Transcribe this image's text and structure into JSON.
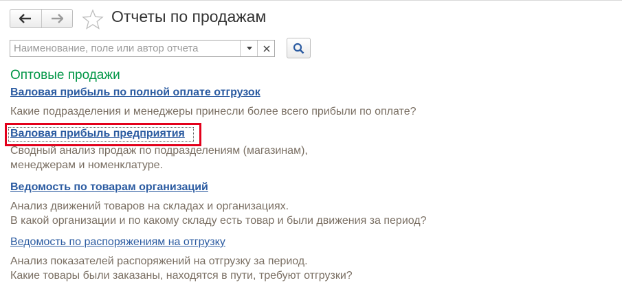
{
  "window": {
    "title": "Отчеты по продажам"
  },
  "search": {
    "placeholder": "Наименование, поле или автор отчета",
    "value": ""
  },
  "groups": [
    {
      "title": "Оптовые продажи",
      "reports": [
        {
          "name": "Валовая прибыль по полной оплате отгрузок",
          "description": "Какие подразделения и менеджеры принесли более всего прибыли по оплате?"
        },
        {
          "name": "Валовая прибыль предприятия",
          "description_lines": [
            "Сводный анализ продаж по подразделениям (магазинам),",
            "менеджерам и номенклатуре."
          ],
          "highlighted": true
        },
        {
          "name": "Ведомость по товарам организаций",
          "description_lines": [
            "Анализ движений товаров на складах и организациях.",
            "В какой организации и по какому складу есть товар и были движения за период?"
          ]
        },
        {
          "name": "Ведомость по распоряжениям на отгрузку",
          "description_lines": [
            "Анализ показателей распоряжений на отгрузку за период.",
            "Какие товары были заказаны, находятся в пути, требуют отгрузки?"
          ]
        }
      ]
    }
  ],
  "icons": {
    "back": "arrow-left-icon",
    "forward": "arrow-right-icon",
    "favorite": "star-outline-icon",
    "dropdown": "triangle-down-icon",
    "clear": "x-icon",
    "find": "magnifier-icon"
  },
  "colors": {
    "group_title": "#009646",
    "link": "#2b5ba1",
    "description": "#7a6f63",
    "highlight_frame": "#e3001b"
  }
}
